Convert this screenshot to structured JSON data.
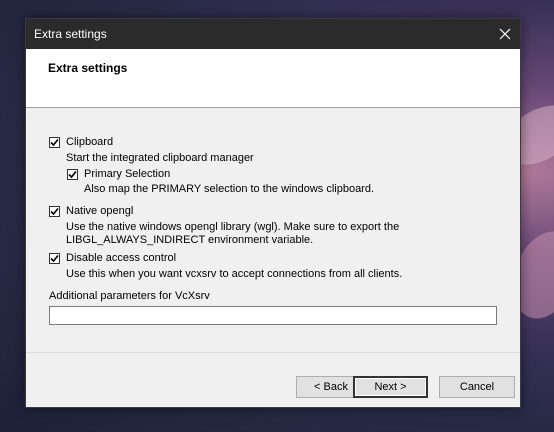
{
  "window": {
    "title": "Extra settings"
  },
  "header": {
    "title": "Extra settings"
  },
  "options": {
    "clipboard": {
      "label": "Clipboard",
      "description": "Start the integrated clipboard manager",
      "checked": true
    },
    "primary_selection": {
      "label": "Primary Selection",
      "description": "Also map the PRIMARY selection to the windows clipboard.",
      "checked": true
    },
    "native_opengl": {
      "label": "Native opengl",
      "description_line1": "Use the native windows opengl library (wgl). Make sure to export the",
      "description_line2": "LIBGL_ALWAYS_INDIRECT environment variable.",
      "checked": true
    },
    "disable_access_control": {
      "label": "Disable access control",
      "description": "Use this when you want vcxsrv to accept connections from all clients.",
      "checked": true
    }
  },
  "additional_params": {
    "label": "Additional parameters for VcXsrv",
    "value": ""
  },
  "buttons": {
    "back": "< Back",
    "next": "Next >",
    "cancel": "Cancel"
  }
}
